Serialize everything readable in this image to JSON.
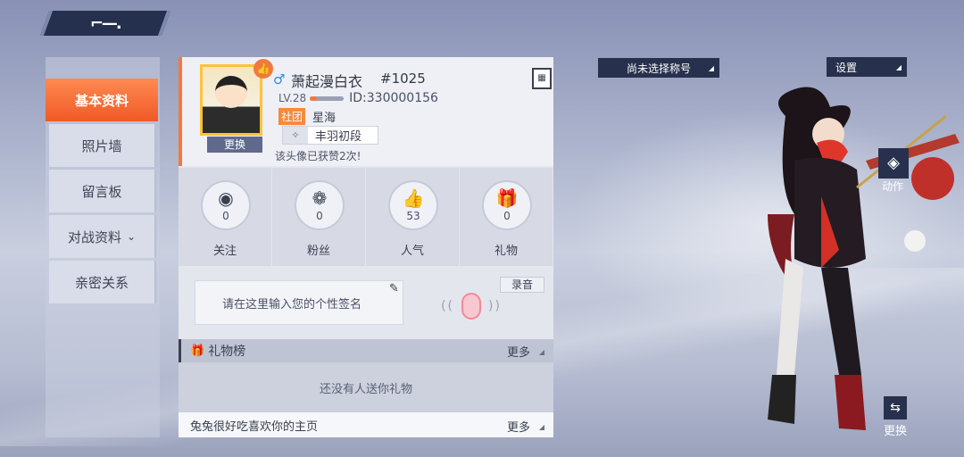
{
  "back": {
    "icon": "back-arrow-icon",
    "glyph": "⌐—."
  },
  "sidebar": {
    "items": [
      {
        "label": "基本资料",
        "active": true
      },
      {
        "label": "照片墙"
      },
      {
        "label": "留言板"
      },
      {
        "label": "对战资料",
        "chevron": "⌄"
      },
      {
        "label": "亲密关系"
      }
    ]
  },
  "profile": {
    "gender": "♂",
    "nickname": "萧起漫白衣",
    "tag": "#1025",
    "level": "LV.28",
    "level_progress": 0.2,
    "id": "ID:330000156",
    "club_badge": "社团",
    "club_name": "星海",
    "rank": "丰羽初段",
    "likes_note": "该头像已获赞2次!",
    "change_button": "更换",
    "qr_glyph": "▦"
  },
  "stats": [
    {
      "label": "关注",
      "value": "0",
      "icon": "eye-icon",
      "glyph": "◉"
    },
    {
      "label": "粉丝",
      "value": "0",
      "icon": "fans-icon",
      "glyph": "❁"
    },
    {
      "label": "人气",
      "value": "53",
      "icon": "thumbs-up-icon",
      "glyph": "👍"
    },
    {
      "label": "礼物",
      "value": "0",
      "icon": "gift-icon",
      "glyph": "🎁"
    }
  ],
  "signature": {
    "placeholder": "请在这里输入您的个性签名",
    "record_button": "录音"
  },
  "gift_board": {
    "title": "礼物榜",
    "more": "更多",
    "empty": "还没有人送你礼物"
  },
  "visitor": {
    "text": "兔兔很好吃喜欢你的主页",
    "more": "更多"
  },
  "right": {
    "title_select": "尚未选择称号",
    "settings": "设置",
    "action_label": "动作",
    "swap_label": "更换"
  },
  "colors": {
    "accent": "#f07a3c",
    "dark_button": "#27314d"
  }
}
